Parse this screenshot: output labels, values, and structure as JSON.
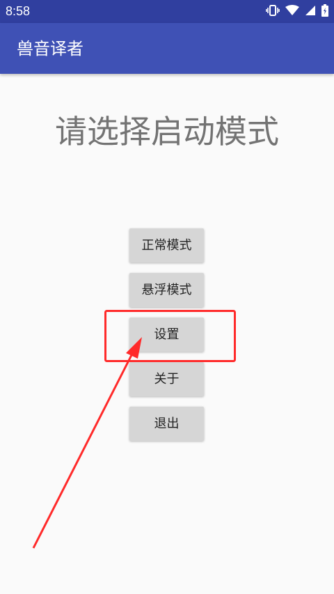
{
  "status_bar": {
    "time": "8:58",
    "icons": [
      "vibrate-icon",
      "wifi-icon",
      "signal-icon",
      "battery-icon"
    ]
  },
  "app_bar": {
    "title": "兽音译者"
  },
  "main": {
    "headline": "请选择启动模式",
    "buttons": [
      {
        "label": "正常模式"
      },
      {
        "label": "悬浮模式"
      },
      {
        "label": "设置"
      },
      {
        "label": "关于"
      },
      {
        "label": "退出"
      }
    ]
  },
  "colors": {
    "status_bar": "#303f9f",
    "app_bar": "#3f51b5",
    "background": "#fafafa",
    "button": "#d6d6d6",
    "annotation": "#ff2a2a"
  }
}
